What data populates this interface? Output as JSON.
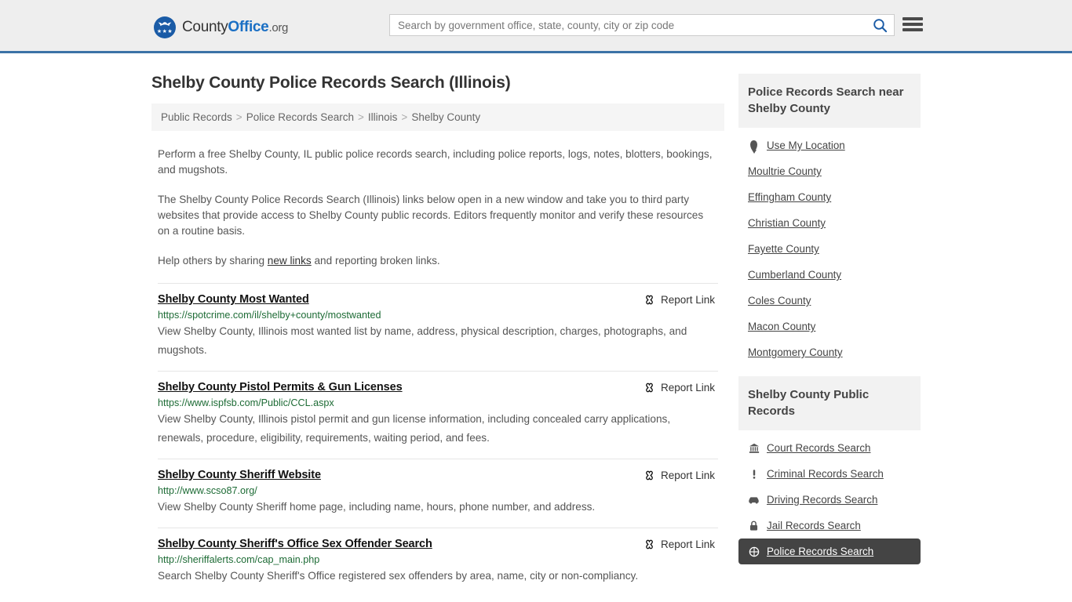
{
  "header": {
    "logo": {
      "part1": "County",
      "part2": "Office",
      "part3": ".org",
      "stars": "★★★"
    },
    "search": {
      "placeholder": "Search by government office, state, county, city or zip code",
      "value": "",
      "search_icon": "search-icon"
    },
    "menu_icon": "hamburger-menu-icon"
  },
  "page": {
    "title": "Shelby County Police Records Search (Illinois)"
  },
  "breadcrumb": {
    "items": [
      {
        "label": "Public Records"
      },
      {
        "label": "Police Records Search"
      },
      {
        "label": "Illinois"
      },
      {
        "label": "Shelby County"
      }
    ],
    "separator": ">"
  },
  "intro": {
    "p1": "Perform a free Shelby County, IL public police records search, including police reports, logs, notes, blotters, bookings, and mugshots.",
    "p2": "The Shelby County Police Records Search (Illinois) links below open in a new window and take you to third party websites that provide access to Shelby County public records. Editors frequently monitor and verify these resources on a routine basis.",
    "p3_before": "Help others by sharing ",
    "p3_link": "new links",
    "p3_after": " and reporting broken links."
  },
  "results": {
    "report_label": "Report Link",
    "report_icon": "broken-link-icon",
    "items": [
      {
        "title": "Shelby County Most Wanted",
        "url": "https://spotcrime.com/il/shelby+county/mostwanted",
        "description": "View Shelby County, Illinois most wanted list by name, address, physical description, charges, photographs, and mugshots."
      },
      {
        "title": "Shelby County Pistol Permits & Gun Licenses",
        "url": "https://www.ispfsb.com/Public/CCL.aspx",
        "description": "View Shelby County, Illinois pistol permit and gun license information, including concealed carry applications, renewals, procedure, eligibility, requirements, waiting period, and fees."
      },
      {
        "title": "Shelby County Sheriff Website",
        "url": "http://www.scso87.org/",
        "description": "View Shelby County Sheriff home page, including name, hours, phone number, and address."
      },
      {
        "title": "Shelby County Sheriff's Office Sex Offender Search",
        "url": "http://sheriffalerts.com/cap_main.php",
        "description": "Search Shelby County Sheriff's Office registered sex offenders by area, name, city or non-compliancy."
      }
    ]
  },
  "sidebar": {
    "nearby": {
      "heading": "Police Records Search near Shelby County",
      "items": [
        {
          "label": "Use My Location",
          "icon": "map-pin-icon"
        },
        {
          "label": "Moultrie County",
          "icon": ""
        },
        {
          "label": "Effingham County",
          "icon": ""
        },
        {
          "label": "Christian County",
          "icon": ""
        },
        {
          "label": "Fayette County",
          "icon": ""
        },
        {
          "label": "Cumberland County",
          "icon": ""
        },
        {
          "label": "Coles County",
          "icon": ""
        },
        {
          "label": "Macon County",
          "icon": ""
        },
        {
          "label": "Montgomery County",
          "icon": ""
        }
      ]
    },
    "public_records": {
      "heading": "Shelby County Public Records",
      "items": [
        {
          "label": "Court Records Search",
          "icon": "courthouse-icon",
          "active": false
        },
        {
          "label": "Criminal Records Search",
          "icon": "exclamation-icon",
          "active": false
        },
        {
          "label": "Driving Records Search",
          "icon": "car-icon",
          "active": false
        },
        {
          "label": "Jail Records Search",
          "icon": "lock-icon",
          "active": false
        },
        {
          "label": "Police Records Search",
          "icon": "police-badge-icon",
          "active": true
        }
      ]
    }
  },
  "colors": {
    "header_bg": "#eeeeee",
    "header_border": "#3b72a6",
    "brand_blue": "#1a6fc4",
    "url_green": "#1d6b35",
    "panel_bg": "#f2f2f2",
    "active_bg": "#444444"
  }
}
